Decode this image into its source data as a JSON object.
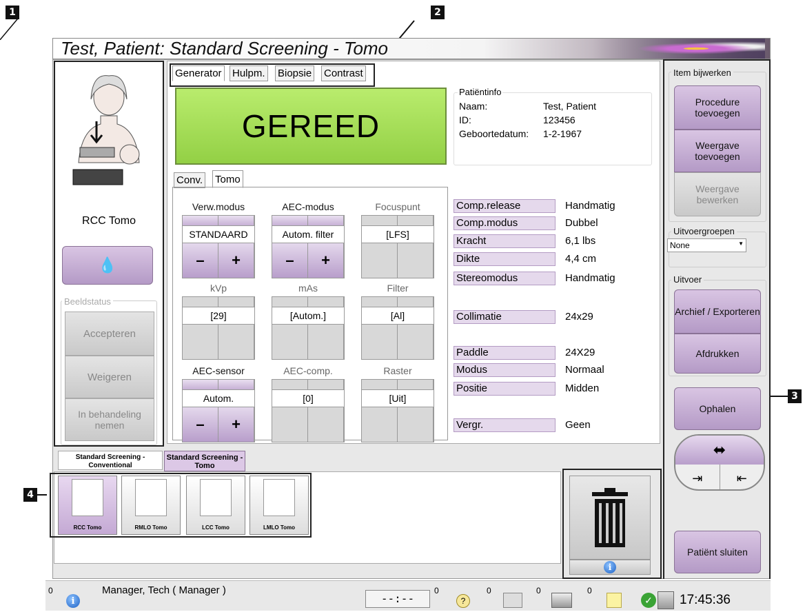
{
  "title": "Test, Patient:  Standard Screening - Tomo",
  "callouts": [
    "1",
    "2",
    "3",
    "4"
  ],
  "tabs": [
    "Generator",
    "Hulpm.",
    "Biopsie",
    "Contrast"
  ],
  "subtabs": [
    "Conv.",
    "Tomo"
  ],
  "status": "GEREED",
  "patient_info": {
    "heading": "Patiëntinfo",
    "name_label": "Naam:",
    "name": "Test, Patient",
    "id_label": "ID:",
    "id": "123456",
    "dob_label": "Geboortedatum:",
    "dob": "1-2-1967"
  },
  "view_name": "RCC Tomo",
  "image_status": {
    "title": "Beeldstatus",
    "accept": "Accepteren",
    "reject": "Weigeren",
    "pending": "In behandeling nemen"
  },
  "controls": {
    "verw": {
      "label": "Verw.modus",
      "value": "STANDAARD"
    },
    "aec_mode": {
      "label": "AEC-modus",
      "value": "Autom. filter"
    },
    "focus": {
      "label": "Focuspunt",
      "value": "[LFS]"
    },
    "kvp": {
      "label": "kVp",
      "value": "[29]"
    },
    "mas": {
      "label": "mAs",
      "value": "[Autom.]"
    },
    "filter": {
      "label": "Filter",
      "value": "[Al]"
    },
    "aec_sensor": {
      "label": "AEC-sensor",
      "value": "Autom."
    },
    "aec_comp": {
      "label": "AEC-comp.",
      "value": "[0]"
    },
    "raster": {
      "label": "Raster",
      "value": "[Uit]"
    },
    "minus": "–",
    "plus": "+"
  },
  "properties": [
    {
      "name": "Comp.release",
      "value": "Handmatig"
    },
    {
      "name": "Comp.modus",
      "value": "Dubbel"
    },
    {
      "name": "Kracht",
      "value": "6,1 lbs"
    },
    {
      "name": "Dikte",
      "value": "4,4 cm"
    },
    {
      "name": "Stereomodus",
      "value": "Handmatig"
    },
    {
      "name": "Collimatie",
      "value": "24x29"
    },
    {
      "name": "Paddle",
      "value": "24X29"
    },
    {
      "name": "Modus",
      "value": "Normaal"
    },
    {
      "name": "Positie",
      "value": "Midden"
    },
    {
      "name": "Vergr.",
      "value": "Geen"
    }
  ],
  "right": {
    "item_group": "Item bijwerken",
    "add_procedure": "Procedure toevoegen",
    "add_view": "Weergave toevoegen",
    "edit_view": "Weergave bewerken",
    "output_groups": "Uitvoergroepen",
    "output_select": "None",
    "output": "Uitvoer",
    "archive": "Archief / Exporteren",
    "print": "Afdrukken",
    "retrieve": "Ophalen",
    "close_patient": "Patiënt sluiten"
  },
  "procedure_tabs": [
    "Standard Screening - Conventional",
    "Standard Screening - Tomo"
  ],
  "thumbnails": [
    "RCC Tomo",
    "RMLO Tomo",
    "LCC Tomo",
    "LMLO Tomo"
  ],
  "statusbar": {
    "user": "Manager, Tech ( Manager )",
    "timer": "--:--",
    "counts": [
      "0",
      "0",
      "0",
      "0",
      "0",
      "0"
    ],
    "clock": "17:45:36"
  },
  "colors": {
    "ready": "#a6e05a",
    "accent": "#b49ac6"
  }
}
